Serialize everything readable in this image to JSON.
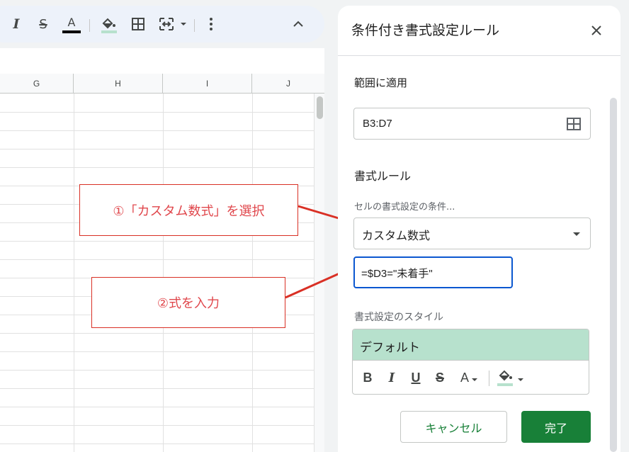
{
  "toolbar": {
    "italic_label": "I",
    "strike_label": "S",
    "text_color_label": "A",
    "icons": [
      "italic-icon",
      "strikethrough-icon",
      "text-color-icon",
      "fill-color-icon",
      "borders-icon",
      "merge-cells-icon",
      "more-vert-icon",
      "chevron-up-icon"
    ],
    "fill_color_bar": "#b7e1cd"
  },
  "grid": {
    "columns": [
      "G",
      "H",
      "I",
      "J"
    ]
  },
  "annotations": {
    "step1": "①「カスタム数式」を選択",
    "step2": "②式を入力",
    "color": "#e0474c"
  },
  "panel": {
    "title": "条件付き書式設定ルール",
    "range_label": "範囲に適用",
    "range_value": "B3:D7",
    "rules_heading": "書式ルール",
    "condition_label": "セルの書式設定の条件...",
    "condition_value": "カスタム数式",
    "formula_value": "=$D3=\"未着手\"",
    "style_label": "書式設定のスタイル",
    "style_preview": "デフォルト",
    "style_buttons": {
      "bold": "B",
      "italic": "I",
      "underline": "U",
      "strike": "S",
      "text_color": "A"
    },
    "style_preview_color": "#b7e1cd",
    "cancel_label": "キャンセル",
    "done_label": "完了",
    "accent_color": "#188038"
  }
}
